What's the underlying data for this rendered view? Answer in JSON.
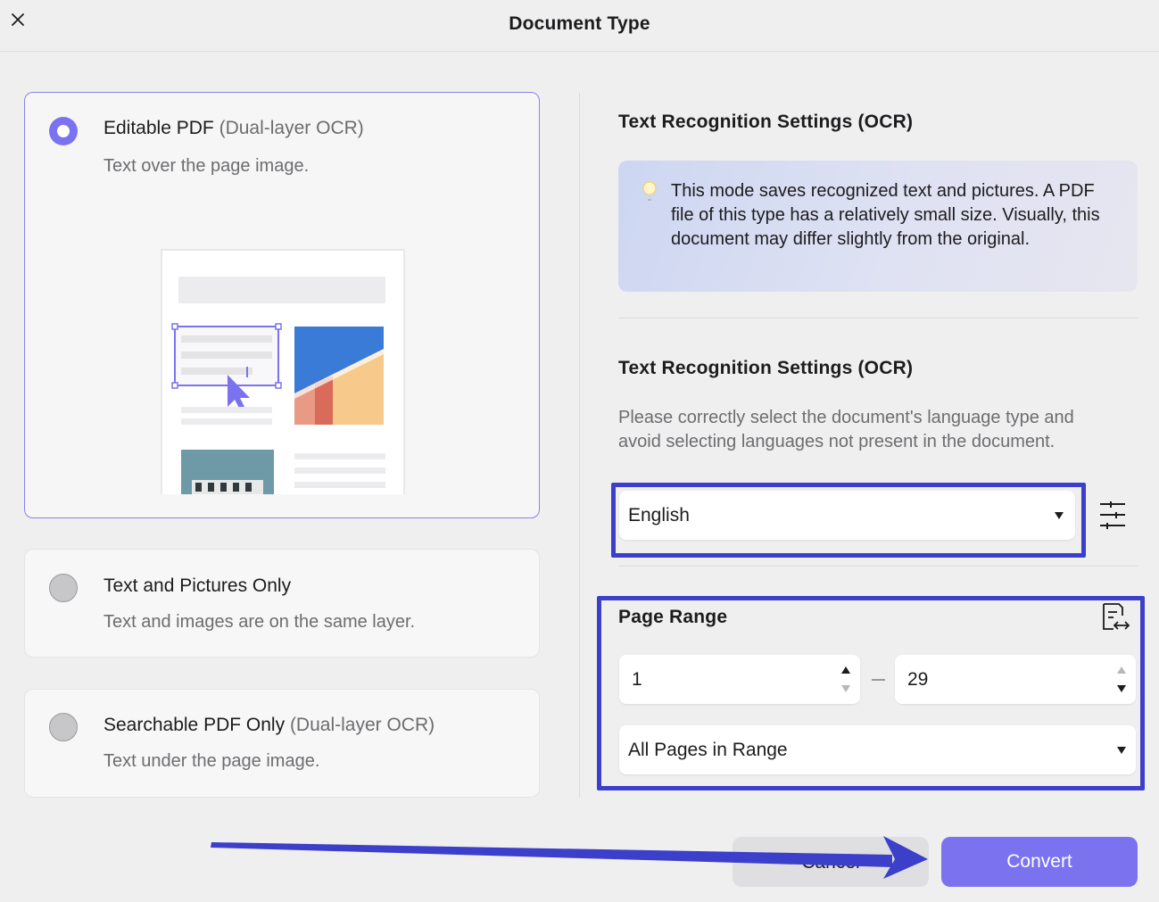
{
  "window": {
    "title": "Document Type",
    "close_icon": "close-icon"
  },
  "options": [
    {
      "title": "Editable PDF",
      "title_suffix": "(Dual-layer OCR)",
      "description": "Text over the page image.",
      "selected": true
    },
    {
      "title": "Text and Pictures Only",
      "title_suffix": "",
      "description": "Text and images are on the same layer.",
      "selected": false
    },
    {
      "title": "Searchable PDF Only",
      "title_suffix": "(Dual-layer OCR)",
      "description": "Text under the page image.",
      "selected": false
    }
  ],
  "ocr_info": {
    "title": "Text Recognition Settings (OCR)",
    "tip_icon": "lightbulb-icon",
    "tip": "This mode saves recognized text and pictures. A PDF file of this type has a relatively small size. Visually, this document may differ slightly from the original."
  },
  "ocr_language": {
    "title": "Text Recognition Settings (OCR)",
    "description": "Please correctly select the document's language type and avoid selecting languages not present in the document.",
    "selected_language": "English",
    "settings_icon": "sliders-icon"
  },
  "page_range": {
    "title": "Page Range",
    "icon": "page-range-icon",
    "from": "1",
    "to": "29",
    "subset": "All Pages in Range"
  },
  "buttons": {
    "cancel": "Cancel",
    "convert": "Convert"
  },
  "colors": {
    "accent": "#7b72f0",
    "annotation_blue": "#3b3fc9"
  }
}
